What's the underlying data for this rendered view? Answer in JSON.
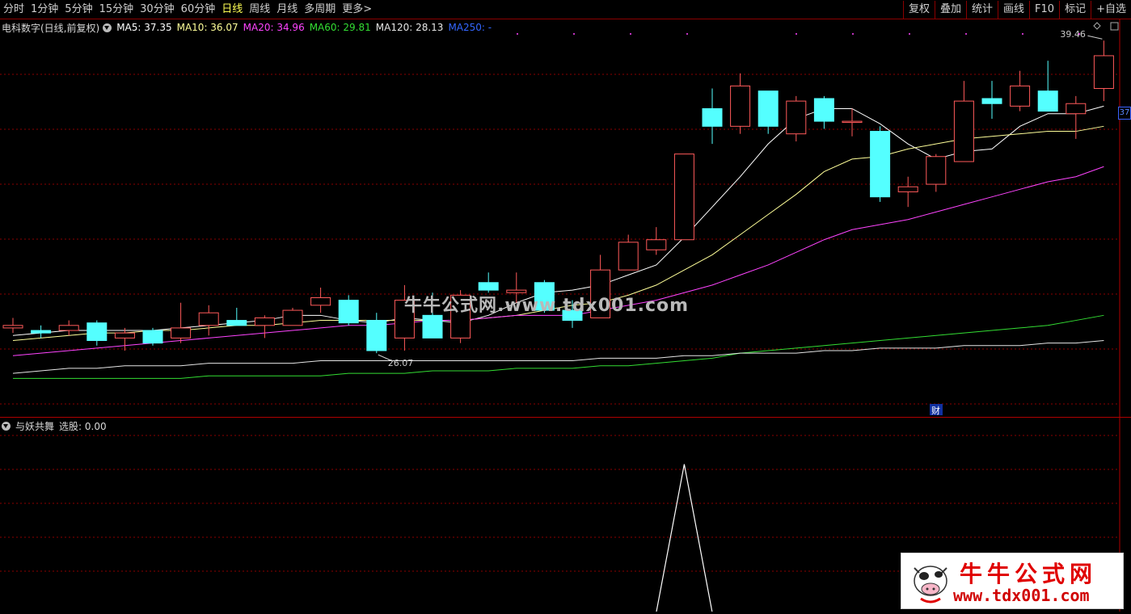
{
  "toolbar": {
    "periods": [
      "分时",
      "1分钟",
      "5分钟",
      "15分钟",
      "30分钟",
      "60分钟",
      "日线",
      "周线",
      "月线",
      "多周期",
      "更多>"
    ],
    "active_period": "日线",
    "right_buttons": [
      "复权",
      "叠加",
      "统计",
      "画线",
      "F10",
      "标记",
      "+自选"
    ]
  },
  "main": {
    "title": "电科数字(日线,前复权)",
    "ma_legend": [
      {
        "label": "MA5: 37.35",
        "color": "#ffffff"
      },
      {
        "label": "MA10: 36.07",
        "color": "#ffff99"
      },
      {
        "label": "MA20: 34.96",
        "color": "#ff44ff"
      },
      {
        "label": "MA60: 29.81",
        "color": "#33dd33"
      },
      {
        "label": "MA120: 28.13",
        "color": "#e6e6e6"
      },
      {
        "label": "MA250: -",
        "color": "#3366ff"
      }
    ],
    "high_label": "39.46",
    "low_label": "26.07",
    "finance_badge": "财",
    "axis_tag": "37"
  },
  "indicator": {
    "title": "与妖共舞",
    "value_label": "选股: 0.00"
  },
  "watermark": {
    "center_text": "牛牛公式网.www.tdx001.com",
    "logo_title": "牛牛公式网",
    "logo_url": "www.tdx001.com"
  },
  "colors": {
    "up": "#ff5a5a",
    "down": "#54ffff",
    "grid": "#8b0000"
  },
  "chart_data": {
    "type": "candlestick",
    "price_range": [
      25.5,
      40.5
    ],
    "candles": [
      {
        "o": 28.9,
        "c": 29.0,
        "h": 29.3,
        "l": 28.7
      },
      {
        "o": 28.8,
        "c": 28.7,
        "h": 29.0,
        "l": 28.5
      },
      {
        "o": 28.8,
        "c": 29.0,
        "h": 29.2,
        "l": 28.6
      },
      {
        "o": 29.1,
        "c": 28.4,
        "h": 29.2,
        "l": 28.2
      },
      {
        "o": 28.5,
        "c": 28.7,
        "h": 28.9,
        "l": 28.0
      },
      {
        "o": 28.8,
        "c": 28.3,
        "h": 28.9,
        "l": 28.2
      },
      {
        "o": 28.5,
        "c": 28.9,
        "h": 29.9,
        "l": 28.3
      },
      {
        "o": 29.0,
        "c": 29.5,
        "h": 29.8,
        "l": 28.6
      },
      {
        "o": 29.2,
        "c": 29.0,
        "h": 29.7,
        "l": 29.0
      },
      {
        "o": 29.0,
        "c": 29.3,
        "h": 29.4,
        "l": 28.5
      },
      {
        "o": 29.0,
        "c": 29.6,
        "h": 29.7,
        "l": 29.0
      },
      {
        "o": 29.8,
        "c": 30.1,
        "h": 30.5,
        "l": 29.5
      },
      {
        "o": 30.0,
        "c": 29.1,
        "h": 30.2,
        "l": 29.0
      },
      {
        "o": 29.2,
        "c": 28.0,
        "h": 29.5,
        "l": 27.9
      },
      {
        "o": 28.5,
        "c": 30.0,
        "h": 30.6,
        "l": 28.0
      },
      {
        "o": 29.4,
        "c": 28.5,
        "h": 30.3,
        "l": 28.5
      },
      {
        "o": 28.5,
        "c": 30.2,
        "h": 30.4,
        "l": 28.3
      },
      {
        "o": 30.7,
        "c": 30.4,
        "h": 31.1,
        "l": 30.3
      },
      {
        "o": 30.3,
        "c": 30.4,
        "h": 31.1,
        "l": 29.9
      },
      {
        "o": 30.7,
        "c": 29.6,
        "h": 30.8,
        "l": 29.5
      },
      {
        "o": 29.6,
        "c": 29.2,
        "h": 30.0,
        "l": 28.9
      },
      {
        "o": 29.3,
        "c": 31.2,
        "h": 31.8,
        "l": 29.3
      },
      {
        "o": 31.2,
        "c": 32.3,
        "h": 32.6,
        "l": 31.2
      },
      {
        "o": 32.0,
        "c": 32.4,
        "h": 32.9,
        "l": 31.8
      },
      {
        "o": 32.4,
        "c": 35.8,
        "h": 35.8,
        "l": 32.4
      },
      {
        "o": 37.6,
        "c": 36.9,
        "h": 38.4,
        "l": 36.2
      },
      {
        "o": 36.9,
        "c": 38.5,
        "h": 39.0,
        "l": 36.6
      },
      {
        "o": 38.3,
        "c": 36.9,
        "h": 38.3,
        "l": 36.6
      },
      {
        "o": 36.6,
        "c": 37.9,
        "h": 38.1,
        "l": 36.3
      },
      {
        "o": 38.0,
        "c": 37.1,
        "h": 38.1,
        "l": 36.8
      },
      {
        "o": 37.1,
        "c": 37.1,
        "h": 37.6,
        "l": 36.5
      },
      {
        "o": 36.7,
        "c": 34.1,
        "h": 36.9,
        "l": 33.9
      },
      {
        "o": 34.3,
        "c": 34.5,
        "h": 34.9,
        "l": 33.7
      },
      {
        "o": 34.6,
        "c": 35.7,
        "h": 35.8,
        "l": 34.3
      },
      {
        "o": 35.5,
        "c": 37.9,
        "h": 38.7,
        "l": 35.5
      },
      {
        "o": 38.0,
        "c": 37.8,
        "h": 38.7,
        "l": 37.2
      },
      {
        "o": 37.7,
        "c": 38.5,
        "h": 39.1,
        "l": 37.5
      },
      {
        "o": 38.3,
        "c": 37.5,
        "h": 39.5,
        "l": 37.5
      },
      {
        "o": 37.4,
        "c": 37.8,
        "h": 38.1,
        "l": 36.4
      },
      {
        "o": 38.4,
        "c": 39.7,
        "h": 40.3,
        "l": 37.9
      }
    ],
    "ma": {
      "MA5": [
        28.6,
        28.7,
        28.8,
        28.8,
        28.8,
        28.8,
        28.9,
        29.0,
        29.1,
        29.2,
        29.4,
        29.4,
        29.2,
        29.1,
        29.3,
        29.2,
        29.1,
        29.4,
        29.9,
        30.3,
        30.4,
        30.6,
        31.0,
        31.4,
        32.5,
        33.7,
        34.9,
        36.2,
        37.2,
        37.6,
        37.6,
        37.0,
        36.2,
        35.6,
        35.9,
        36.0,
        36.9,
        37.4,
        37.4,
        37.7
      ],
      "MA10": [
        28.4,
        28.5,
        28.6,
        28.7,
        28.7,
        28.8,
        28.8,
        28.9,
        29.0,
        29.0,
        29.1,
        29.2,
        29.2,
        29.2,
        29.2,
        29.2,
        29.2,
        29.3,
        29.4,
        29.6,
        29.8,
        29.9,
        30.2,
        30.6,
        31.2,
        31.8,
        32.6,
        33.4,
        34.2,
        35.1,
        35.6,
        35.7,
        36.0,
        36.2,
        36.4,
        36.5,
        36.6,
        36.7,
        36.7,
        36.9
      ],
      "MA20": [
        27.8,
        27.9,
        28.0,
        28.1,
        28.2,
        28.3,
        28.4,
        28.5,
        28.6,
        28.7,
        28.8,
        28.9,
        29.0,
        29.0,
        29.1,
        29.2,
        29.2,
        29.3,
        29.4,
        29.4,
        29.4,
        29.6,
        29.8,
        30.0,
        30.3,
        30.6,
        31.0,
        31.4,
        31.9,
        32.4,
        32.8,
        33.0,
        33.2,
        33.5,
        33.8,
        34.1,
        34.4,
        34.7,
        34.9,
        35.3
      ],
      "MA60": [
        26.9,
        26.9,
        26.9,
        26.9,
        26.9,
        26.9,
        26.9,
        27.0,
        27.0,
        27.0,
        27.0,
        27.0,
        27.1,
        27.1,
        27.1,
        27.2,
        27.2,
        27.2,
        27.3,
        27.3,
        27.3,
        27.4,
        27.4,
        27.5,
        27.6,
        27.7,
        27.9,
        28.0,
        28.1,
        28.2,
        28.3,
        28.4,
        28.5,
        28.6,
        28.7,
        28.8,
        28.9,
        29.0,
        29.2,
        29.4
      ],
      "MA120": [
        27.1,
        27.2,
        27.3,
        27.3,
        27.4,
        27.4,
        27.4,
        27.5,
        27.5,
        27.5,
        27.5,
        27.6,
        27.6,
        27.6,
        27.6,
        27.6,
        27.6,
        27.6,
        27.6,
        27.6,
        27.6,
        27.7,
        27.7,
        27.7,
        27.8,
        27.8,
        27.9,
        27.9,
        27.9,
        28.0,
        28.0,
        28.1,
        28.1,
        28.1,
        28.2,
        28.2,
        28.2,
        28.3,
        28.3,
        28.4
      ]
    },
    "indicator_values": [
      0,
      0,
      0,
      0,
      0,
      0,
      0,
      0,
      0,
      0,
      0,
      0,
      0,
      0,
      0,
      0,
      0,
      0,
      0,
      0,
      0,
      0,
      0,
      0,
      1,
      0,
      0,
      0,
      0,
      0,
      0,
      0,
      0,
      0,
      0,
      0,
      0,
      0,
      0,
      0
    ],
    "indicator_range": [
      0,
      1.2
    ]
  }
}
